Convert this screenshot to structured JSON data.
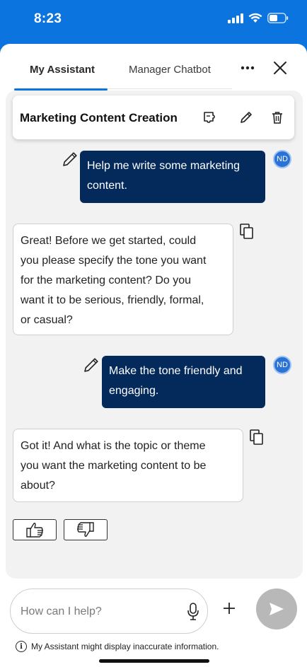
{
  "status_bar": {
    "time": "8:23"
  },
  "tabs": [
    {
      "label": "My Assistant",
      "active": true
    },
    {
      "label": "Manager Chatbot",
      "active": false
    }
  ],
  "header": {
    "more_icon": "more-horizontal-icon",
    "close_icon": "close-icon"
  },
  "conversation": {
    "title": "Marketing Content Creation"
  },
  "messages": [
    {
      "role": "user",
      "avatar": "ND",
      "text_lines": [
        "Help me write some marketing",
        "content."
      ]
    },
    {
      "role": "assistant",
      "text_lines": [
        "Great! Before we get started, could",
        "you please specify the tone you want",
        "for the marketing content? Do you",
        "want it to be serious, friendly, formal,",
        "or casual?"
      ]
    },
    {
      "role": "user",
      "avatar": "ND",
      "text_lines": [
        "Make the tone friendly and",
        "engaging."
      ]
    },
    {
      "role": "assistant",
      "text_lines": [
        "Got it! And what is the topic or theme",
        "you want the marketing content to be",
        "about?"
      ]
    }
  ],
  "input": {
    "placeholder": "How can I help?"
  },
  "disclaimer": {
    "info_glyph": "i",
    "text": "My Assistant might display inaccurate information."
  },
  "colors": {
    "brand_blue": "#0b74de",
    "user_bubble": "#042a5c",
    "avatar": "#2b72d6",
    "send_disabled": "#b8b8b8"
  }
}
